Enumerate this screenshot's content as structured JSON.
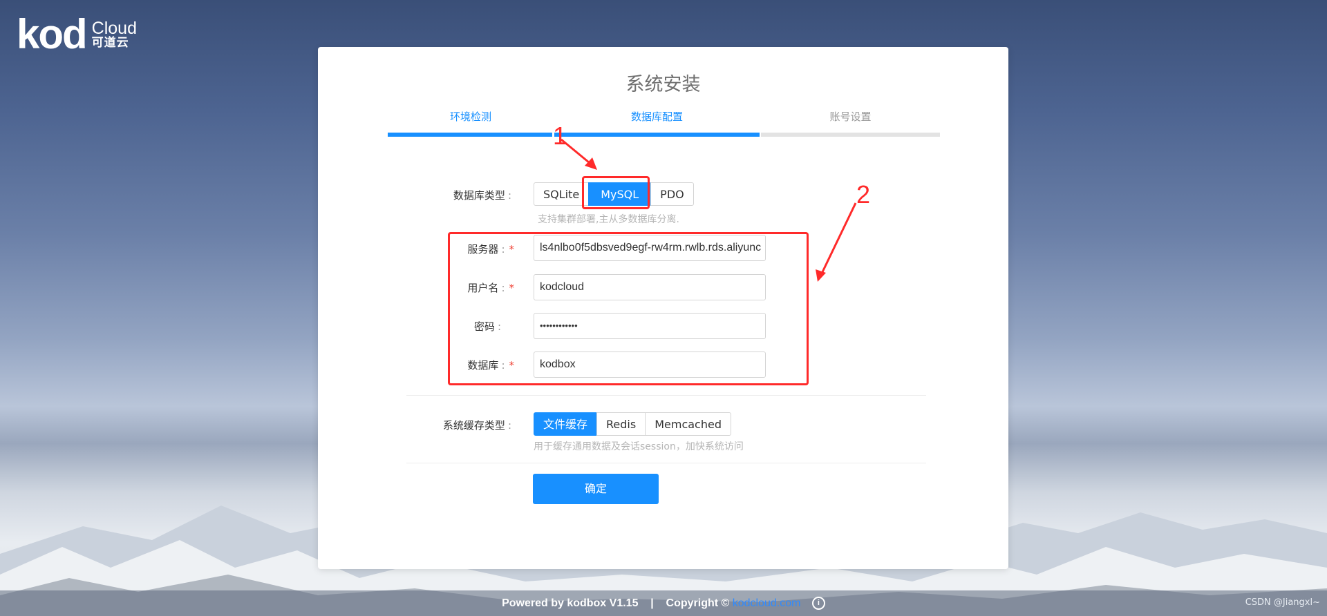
{
  "brand": {
    "mark": "kod",
    "name": "Cloud",
    "subtitle": "可道云"
  },
  "page_title": "系统安装",
  "steps": [
    {
      "label": "环境检测",
      "state": "done"
    },
    {
      "label": "数据库配置",
      "state": "active"
    },
    {
      "label": "账号设置",
      "state": "pending"
    }
  ],
  "db": {
    "type_label": "数据库类型",
    "types": [
      "SQLite",
      "MySQL",
      "PDO"
    ],
    "selected": "MySQL",
    "hint": "支持集群部署,主从多数据库分离.",
    "fields": [
      {
        "label": "服务器",
        "required": true,
        "value": "ls4nlbo0f5dbsved9egf-rw4rm.rwlb.rds.aliyunc"
      },
      {
        "label": "用户名",
        "required": true,
        "value": "kodcloud"
      },
      {
        "label": "密码",
        "required": false,
        "value": "••••••••••••"
      },
      {
        "label": "数据库",
        "required": true,
        "value": "kodbox"
      }
    ]
  },
  "cache": {
    "type_label": "系统缓存类型",
    "types": [
      "文件缓存",
      "Redis",
      "Memcached"
    ],
    "selected": "文件缓存",
    "hint": "用于缓存通用数据及会话session，加快系统访问"
  },
  "submit_label": "确定",
  "annotations": {
    "one": "1",
    "two": "2"
  },
  "footer": {
    "powered": "Powered by kodbox V1.15",
    "separator": "|",
    "copyright": "Copyright ©",
    "link": "kodcloud.com",
    "info_glyph": "i",
    "watermark": "CSDN @Jiangxl~"
  },
  "colors": {
    "accent": "#1890ff",
    "annotation": "#ff2a2a",
    "required": "#f04134"
  }
}
